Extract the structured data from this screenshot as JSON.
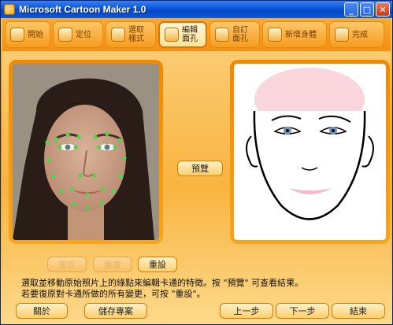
{
  "window": {
    "title": "Microsoft Cartoon Maker 1.0"
  },
  "title_buttons": {
    "minimize": "_",
    "maximize": "□",
    "close": "✕"
  },
  "steps": [
    {
      "label": "開始",
      "icon": "home-icon"
    },
    {
      "label": "定位",
      "icon": "target-icon"
    },
    {
      "label": "選取\n樣式",
      "icon": "grid-icon"
    },
    {
      "label": "編輯\n面孔",
      "icon": "face-icon",
      "active": true
    },
    {
      "label": "自訂\n面孔",
      "icon": "custom-face-icon"
    },
    {
      "label": "新增身體",
      "icon": "body-icon"
    },
    {
      "label": "完成",
      "icon": "finish-icon"
    }
  ],
  "buttons": {
    "preview": "預覽",
    "undo": "復原",
    "redo": "重做",
    "reset": "重設",
    "about": "關於",
    "save_project": "儲存專案",
    "back": "上一步",
    "next": "下一步",
    "finish": "結束"
  },
  "hints": [
    "選取並移動原始照片上的綠點來編輯卡通的特徵。按 \"預覽\" 可查看結果。",
    "若要復原對卡通所做的所有變更，可按 \"重設\"。"
  ],
  "colors": {
    "accent": "#f39016",
    "title_blue": "#0a56d8",
    "landmark": "#4cd64c"
  }
}
